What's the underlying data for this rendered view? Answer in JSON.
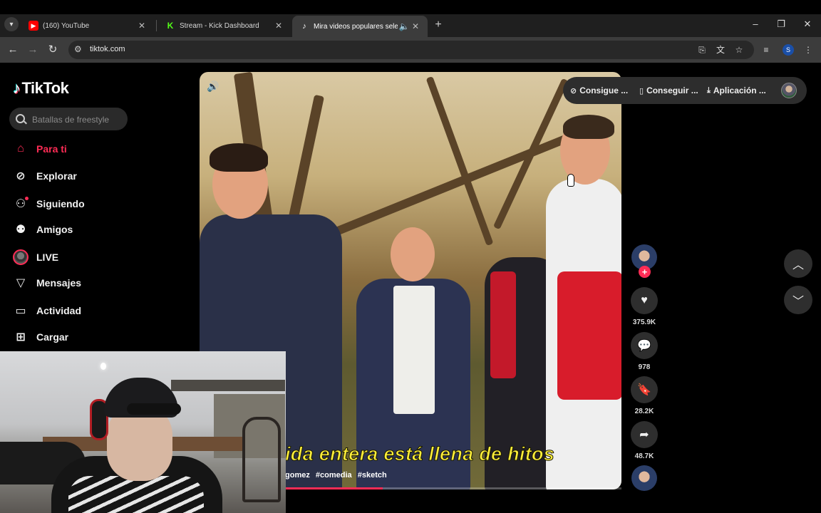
{
  "browser": {
    "tabs": [
      {
        "title": "(160) YouTube",
        "favicon": "youtube-icon",
        "color": "#ff0000"
      },
      {
        "title": "Stream - Kick Dashboard",
        "favicon": "kick-icon",
        "color": "#53fc18"
      },
      {
        "title": "Mira videos populares selec",
        "favicon": "tiktok-icon",
        "color": "#ffffff"
      }
    ],
    "url": "tiktok.com",
    "profile_initial": "S"
  },
  "app": {
    "logo_text": "TikTok",
    "search_placeholder": "Batallas de freestyle",
    "accent": "#fe2c55",
    "nav": [
      {
        "label": "Para ti",
        "icon": "home-icon",
        "active": true
      },
      {
        "label": "Explorar",
        "icon": "compass-icon"
      },
      {
        "label": "Siguiendo",
        "icon": "following-icon"
      },
      {
        "label": "Amigos",
        "icon": "friends-icon"
      },
      {
        "label": "LIVE",
        "icon": "live-icon"
      },
      {
        "label": "Mensajes",
        "icon": "messages-icon"
      },
      {
        "label": "Actividad",
        "icon": "activity-icon"
      },
      {
        "label": "Cargar",
        "icon": "upload-icon"
      }
    ]
  },
  "topbar": {
    "coins_label": "Consigue ...",
    "get_app_label": "Conseguir ...",
    "desktop_app_label": "Aplicación ..."
  },
  "video": {
    "subtitle": "ida entera está llena de hitos",
    "tags": [
      "gomez",
      "#comedia",
      "#sketch"
    ],
    "progress": 0.29
  },
  "actions": {
    "likes": "375.9K",
    "comments": "978",
    "saves": "28.2K",
    "shares": "48.7K"
  }
}
